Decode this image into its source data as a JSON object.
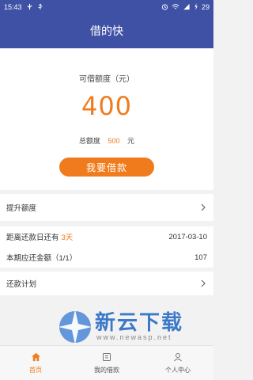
{
  "status_bar": {
    "time": "15:43",
    "battery_level": "29",
    "icons": [
      "usb-icon",
      "usb-debug-icon",
      "alarm-icon",
      "wifi-icon",
      "signal-icon",
      "charging-icon"
    ]
  },
  "header": {
    "title": "借的快"
  },
  "quota": {
    "label": "可借额度（元）",
    "amount": "400",
    "total_label": "总额度",
    "total_value": "500",
    "total_unit": "元",
    "borrow_button": "我要借款"
  },
  "rows": {
    "raise_limit": "提升额度",
    "due_label": "距离还款日还有",
    "due_days": "3天",
    "due_date": "2017-03-10",
    "amount_label": "本期应还金额（1/1）",
    "amount_value": "107",
    "plan_label": "还款计划"
  },
  "tabs": [
    {
      "label": "首页",
      "icon": "home-icon",
      "active": true
    },
    {
      "label": "我的借款",
      "icon": "loan-icon",
      "active": false
    },
    {
      "label": "个人中心",
      "icon": "user-icon",
      "active": false
    }
  ],
  "watermark": {
    "title": "新云下载",
    "url": "www.newasp.net"
  },
  "colors": {
    "primary": "#3f51a5",
    "accent": "#ef7c1f",
    "background": "#f2f2f2"
  }
}
